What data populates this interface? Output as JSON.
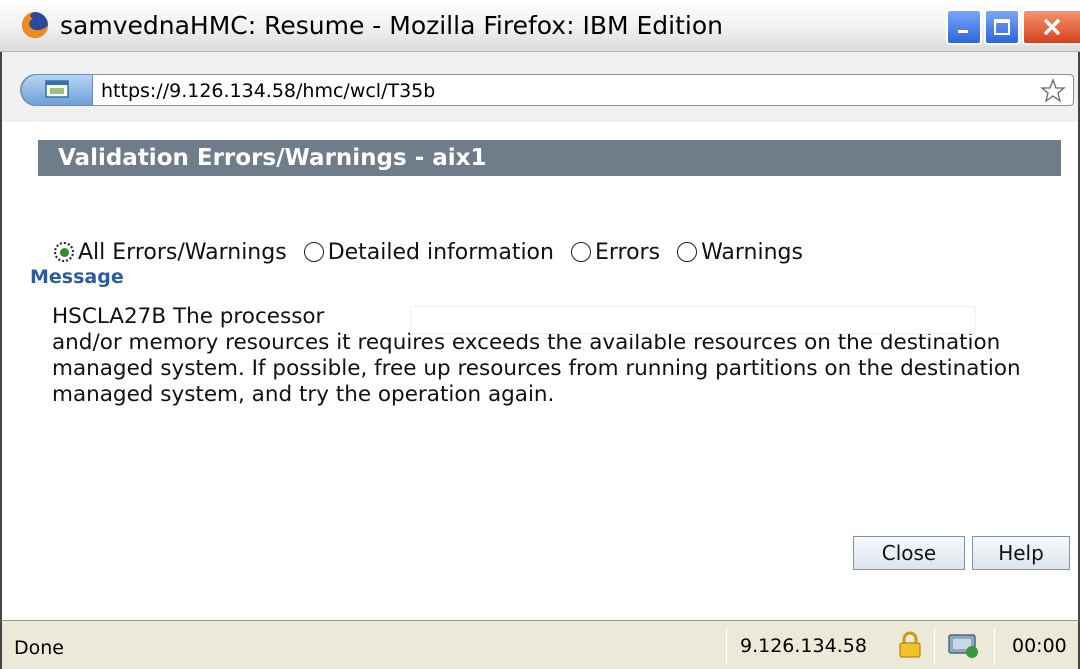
{
  "window": {
    "title": "samvednaHMC: Resume - Mozilla Firefox: IBM Edition",
    "minimize_icon": "minimize-icon",
    "maximize_icon": "maximize-icon",
    "close_icon": "close-icon"
  },
  "addressbar": {
    "url": "https://9.126.134.58/hmc/wcl/T35b",
    "site_icon": "site-identity-icon",
    "bookmark_icon": "star-icon"
  },
  "dialog": {
    "header": "Validation Errors/Warnings - aix1",
    "filters": [
      {
        "label": "All Errors/Warnings",
        "selected": true
      },
      {
        "label": "Detailed information",
        "selected": false
      },
      {
        "label": "Errors",
        "selected": false
      },
      {
        "label": "Warnings",
        "selected": false
      }
    ],
    "message_label": "Message",
    "message_line1": "HSCLA27B The processor",
    "message_rest": "and/or memory resources it requires exceeds the available resources on the destination managed system. If possible, free up resources from running partitions on the destination managed system, and try the operation again.",
    "close_label": "Close",
    "help_label": "Help"
  },
  "statusbar": {
    "status": "Done",
    "host": "9.126.134.58",
    "time": "00:00"
  },
  "colors": {
    "header_bg": "#6f7d8a",
    "message_label": "#2c5ba0",
    "close_button": "#d64020",
    "titlebar_buttons": "#2d65dc"
  }
}
